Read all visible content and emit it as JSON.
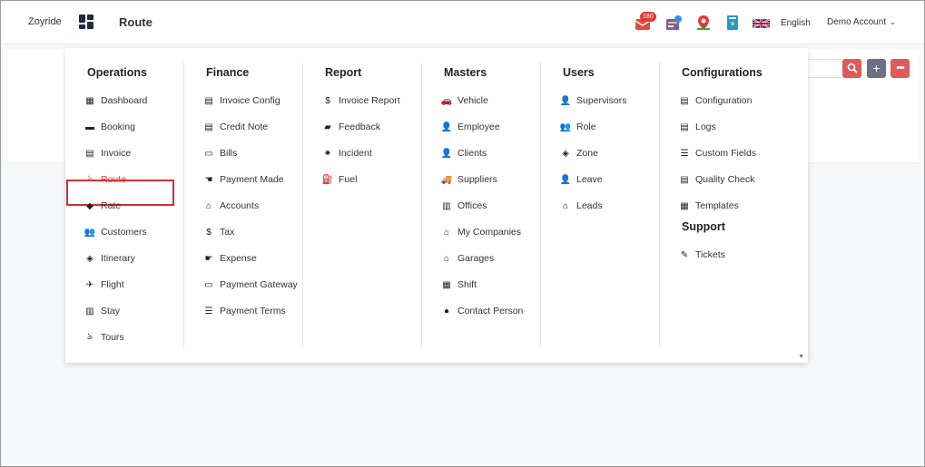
{
  "header": {
    "brand": "Zoyride",
    "page_title": "Route",
    "notification_count": "180",
    "language": "English",
    "account": "Demo Account"
  },
  "colors": {
    "accent_red": "#d84040",
    "search_button": "#e05a5a",
    "add_button": "#6b7085",
    "more_button": "#e05a5a"
  },
  "menu": {
    "operations": {
      "title": "Operations",
      "items": [
        "Dashboard",
        "Booking",
        "Invoice",
        "Route",
        "Rate",
        "Customers",
        "Itinerary",
        "Flight",
        "Stay",
        "Tours"
      ]
    },
    "finance": {
      "title": "Finance",
      "items": [
        "Invoice Config",
        "Credit Note",
        "Bills",
        "Payment Made",
        "Accounts",
        "Tax",
        "Expense",
        "Payment Gateway",
        "Payment Terms"
      ]
    },
    "report": {
      "title": "Report",
      "items": [
        "Invoice Report",
        "Feedback",
        "Incident",
        "Fuel"
      ]
    },
    "masters": {
      "title": "Masters",
      "items": [
        "Vehicle",
        "Employee",
        "Clients",
        "Suppliers",
        "Offices",
        "My Companies",
        "Garages",
        "Shift",
        "Contact Person"
      ]
    },
    "users": {
      "title": "Users",
      "items": [
        "Supervisors",
        "Role",
        "Zone",
        "Leave",
        "Leads"
      ]
    },
    "configurations": {
      "title": "Configurations",
      "items": [
        "Configuration",
        "Logs",
        "Custom Fields",
        "Quality Check",
        "Templates"
      ]
    },
    "support": {
      "title": "Support",
      "items": [
        "Tickets"
      ]
    }
  }
}
